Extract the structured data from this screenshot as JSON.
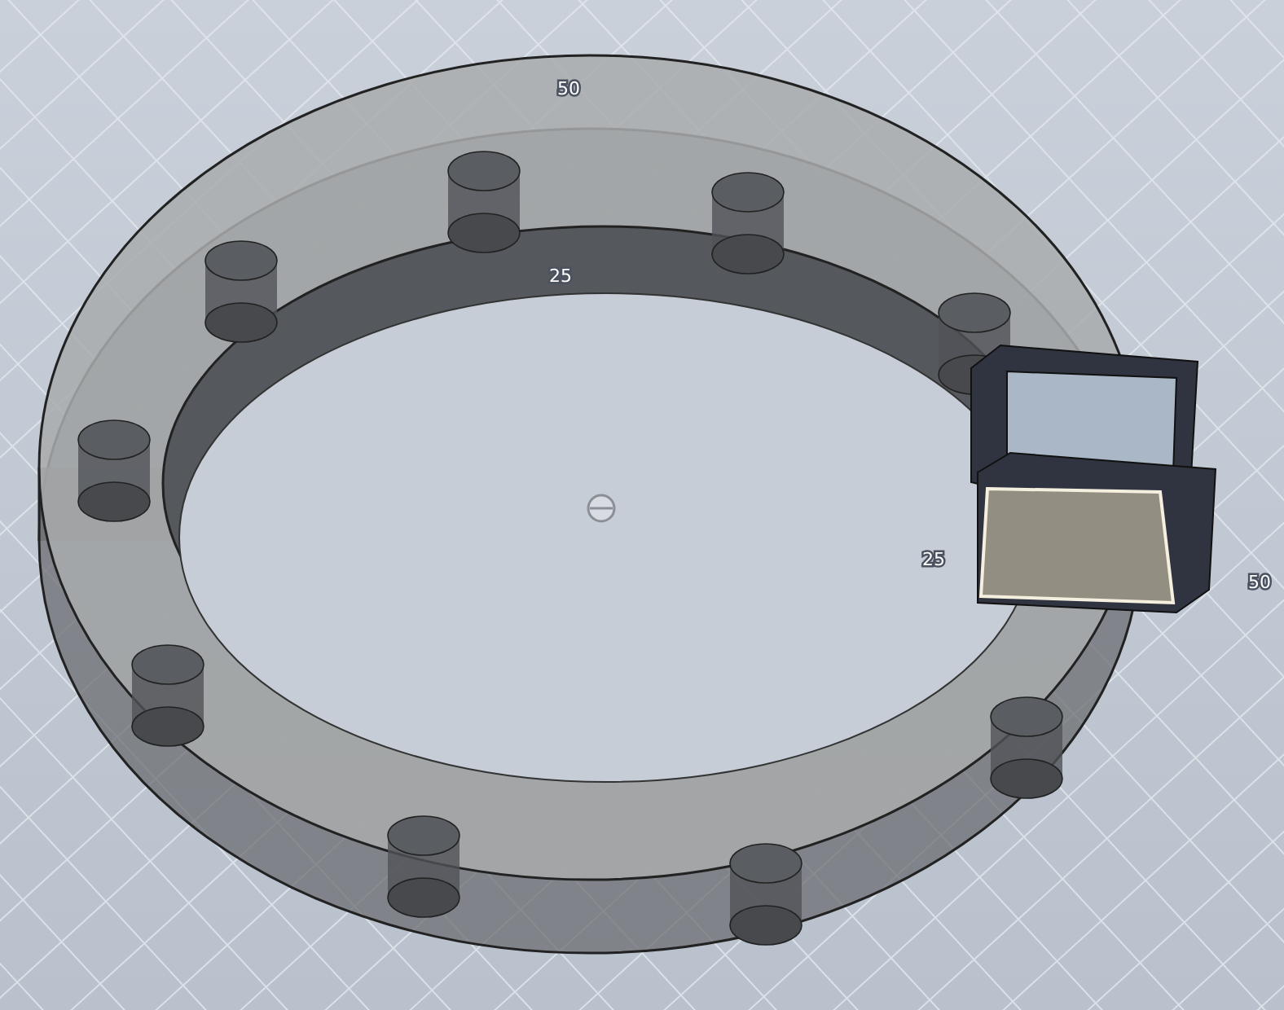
{
  "viewport": {
    "grid_labels": [
      {
        "text": "50"
      },
      {
        "text": "25"
      },
      {
        "text": "25"
      },
      {
        "text": "50"
      }
    ]
  }
}
